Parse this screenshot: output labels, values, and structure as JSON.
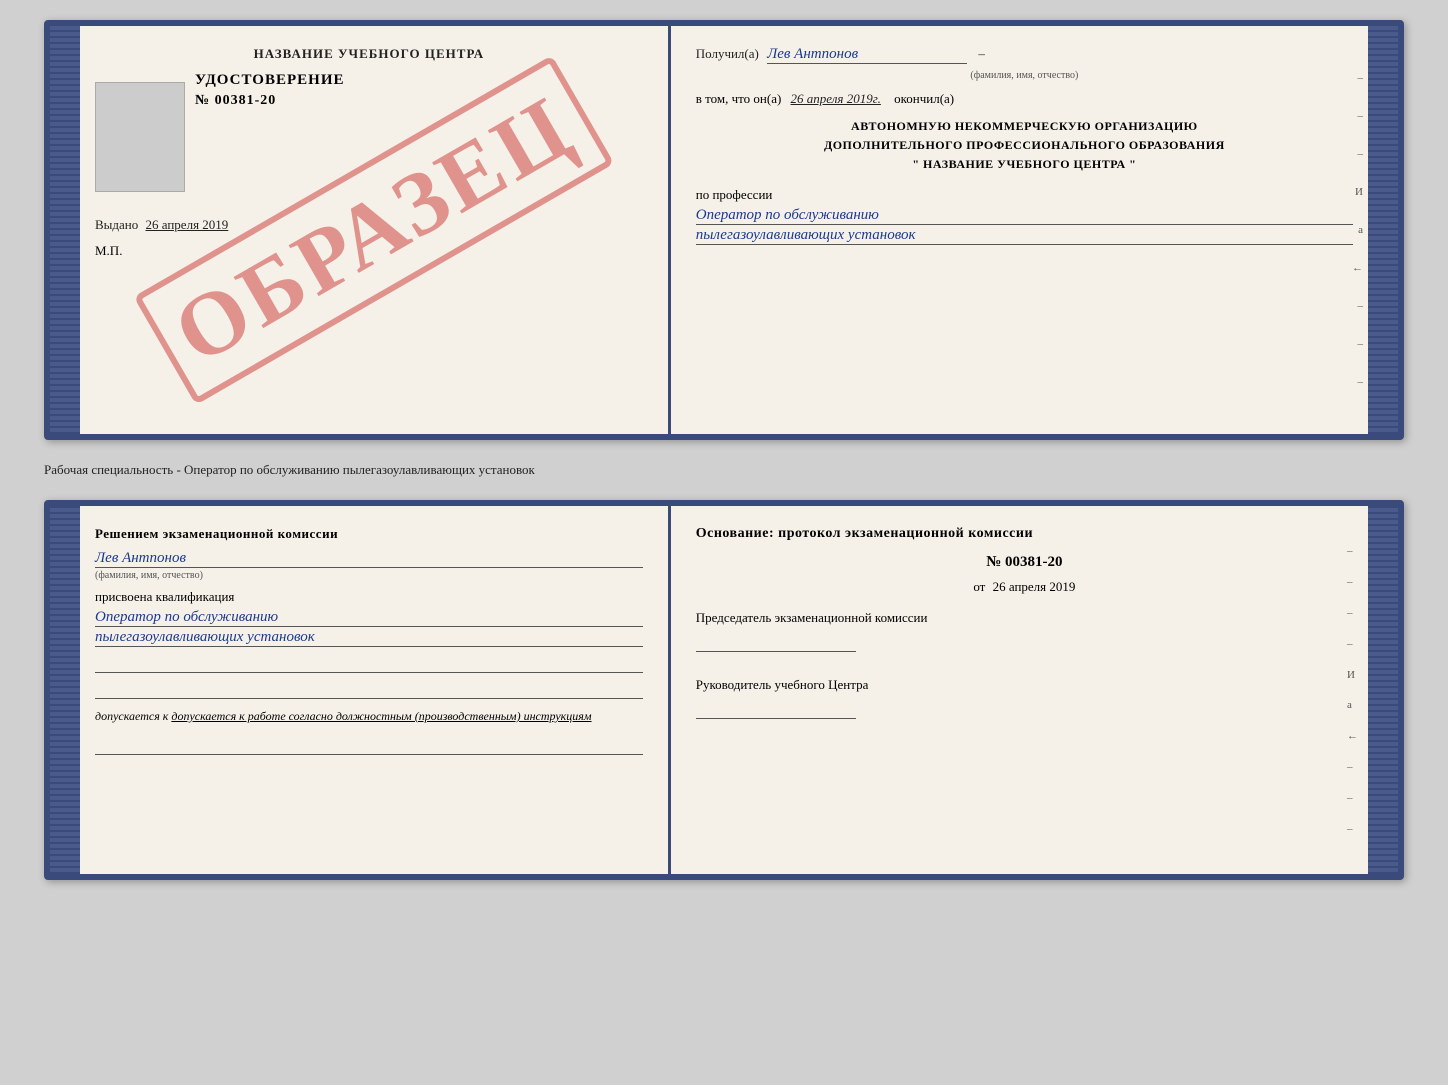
{
  "top_cert": {
    "left": {
      "title": "НАЗВАНИЕ УЧЕБНОГО ЦЕНТРА",
      "cert_word": "УДОСТОВЕРЕНИЕ",
      "cert_number": "№ 00381-20",
      "issued_label": "Выдано",
      "issued_date": "26 апреля 2019",
      "mp_label": "М.П."
    },
    "stamp": "ОБРАЗЕЦ",
    "right": {
      "received_label": "Получил(а)",
      "recipient_name": "Лев Антпонов",
      "name_caption": "(фамилия, имя, отчество)",
      "date_prefix": "в том, что он(а)",
      "date_value": "26 апреля 2019г.",
      "finished_label": "окончил(а)",
      "org_line1": "АВТОНОМНУЮ НЕКОММЕРЧЕСКУЮ ОРГАНИЗАЦИЮ",
      "org_line2": "ДОПОЛНИТЕЛЬНОГО ПРОФЕССИОНАЛЬНОГО ОБРАЗОВАНИЯ",
      "org_line3": "\"   НАЗВАНИЕ УЧЕБНОГО ЦЕНТРА   \"",
      "profession_label": "по профессии",
      "profession_line1": "Оператор по обслуживанию",
      "profession_line2": "пылегазоулавливающих установок",
      "margin_items": [
        "–",
        "–",
        "–",
        "И",
        "а",
        "←",
        "–",
        "–",
        "–"
      ]
    }
  },
  "separator": {
    "text": "Рабочая специальность - Оператор по обслуживанию пылегазоулавливающих установок"
  },
  "bottom_cert": {
    "left": {
      "decision_text": "Решением экзаменационной комиссии",
      "person_name": "Лев Антпонов",
      "name_caption": "(фамилия, имя, отчество)",
      "assigned_label": "присвоена квалификация",
      "qualification_line1": "Оператор по обслуживанию",
      "qualification_line2": "пылегазоулавливающих установок",
      "admitted_text": "допускается к   работе согласно должностным (производственным) инструкциям"
    },
    "right": {
      "basis_title": "Основание: протокол экзаменационной  комиссии",
      "protocol_number": "№  00381-20",
      "protocol_date_prefix": "от",
      "protocol_date": "26 апреля 2019",
      "chairman_label": "Председатель экзаменационной комиссии",
      "head_label": "Руководитель учебного Центра",
      "margin_items": [
        "–",
        "–",
        "–",
        "–",
        "И",
        "а",
        "←",
        "–",
        "–",
        "–"
      ]
    }
  }
}
